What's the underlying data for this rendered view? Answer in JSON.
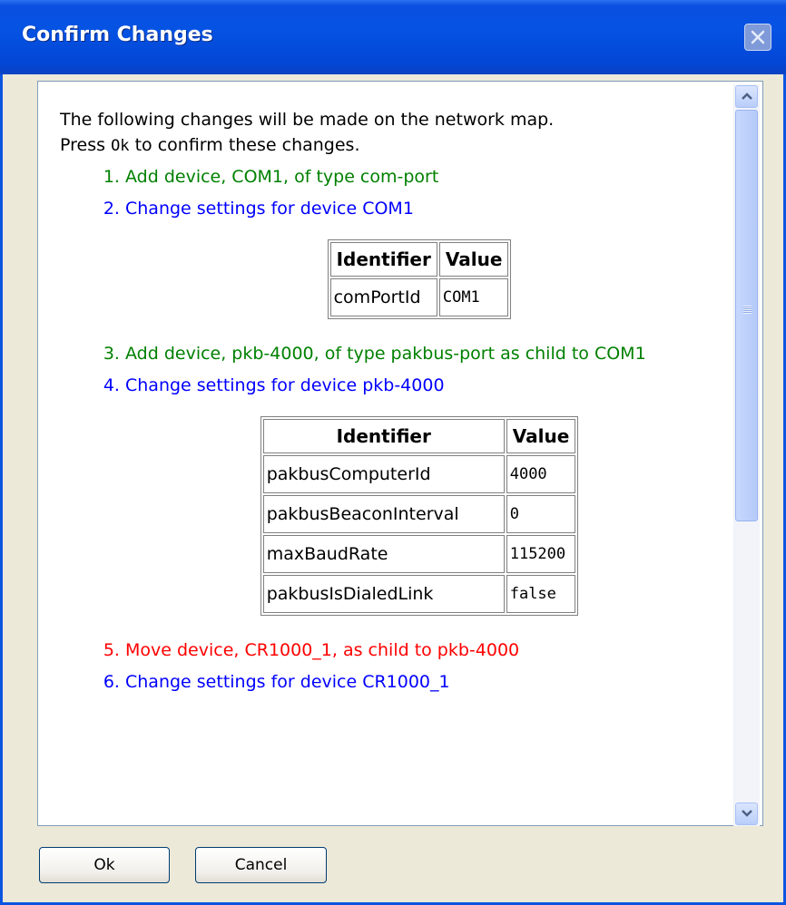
{
  "window": {
    "title": "Confirm Changes"
  },
  "intro": {
    "line1": "The following changes will be made on the network map.",
    "press": "Press",
    "ok_word": "Ok",
    "line2_rest": "to confirm these changes."
  },
  "changes": [
    {
      "text": "Add device, COM1, of type com-port",
      "color": "#008000"
    },
    {
      "text": "Change settings for device COM1",
      "color": "#0000ff",
      "table": {
        "headers": [
          "Identifier",
          "Value"
        ],
        "rows": [
          [
            "comPortId",
            "COM1"
          ]
        ]
      }
    },
    {
      "text": "Add device, pkb-4000, of type pakbus-port as child to COM1",
      "color": "#008000"
    },
    {
      "text": "Change settings for device pkb-4000",
      "color": "#0000ff",
      "table": {
        "headers": [
          "Identifier",
          "Value"
        ],
        "rows": [
          [
            "pakbusComputerId",
            "4000"
          ],
          [
            "pakbusBeaconInterval",
            "0"
          ],
          [
            "maxBaudRate",
            "115200"
          ],
          [
            "pakbusIsDialedLink",
            "false"
          ]
        ]
      }
    },
    {
      "text": "Move device, CR1000_1, as child to pkb-4000",
      "color": "#ff0000"
    },
    {
      "text": "Change settings for device CR1000_1",
      "color": "#0000ff"
    }
  ],
  "buttons": {
    "ok": "Ok",
    "cancel": "Cancel"
  },
  "icons": {
    "close": "close-icon",
    "scroll_up": "chevron-up-icon",
    "scroll_down": "chevron-down-icon"
  }
}
